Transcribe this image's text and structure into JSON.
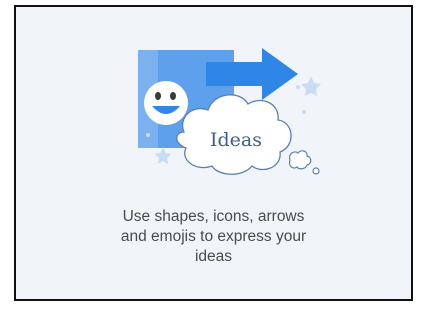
{
  "card": {
    "illustration": {
      "cloud_label": "Ideas",
      "icons": [
        "smiley-face-icon",
        "right-arrow-icon",
        "thought-cloud-icon",
        "star-icon"
      ],
      "colors": {
        "square": "#5fa0ec",
        "square_light": "#8fbdf3",
        "arrow": "#2f86e6",
        "cloud_stroke": "#5a7fb8",
        "star": "#c8ddf4",
        "background": "#f1f5fa"
      }
    },
    "caption_lines": [
      "Use shapes, icons, arrows",
      "and emojis to express your",
      "ideas"
    ]
  }
}
